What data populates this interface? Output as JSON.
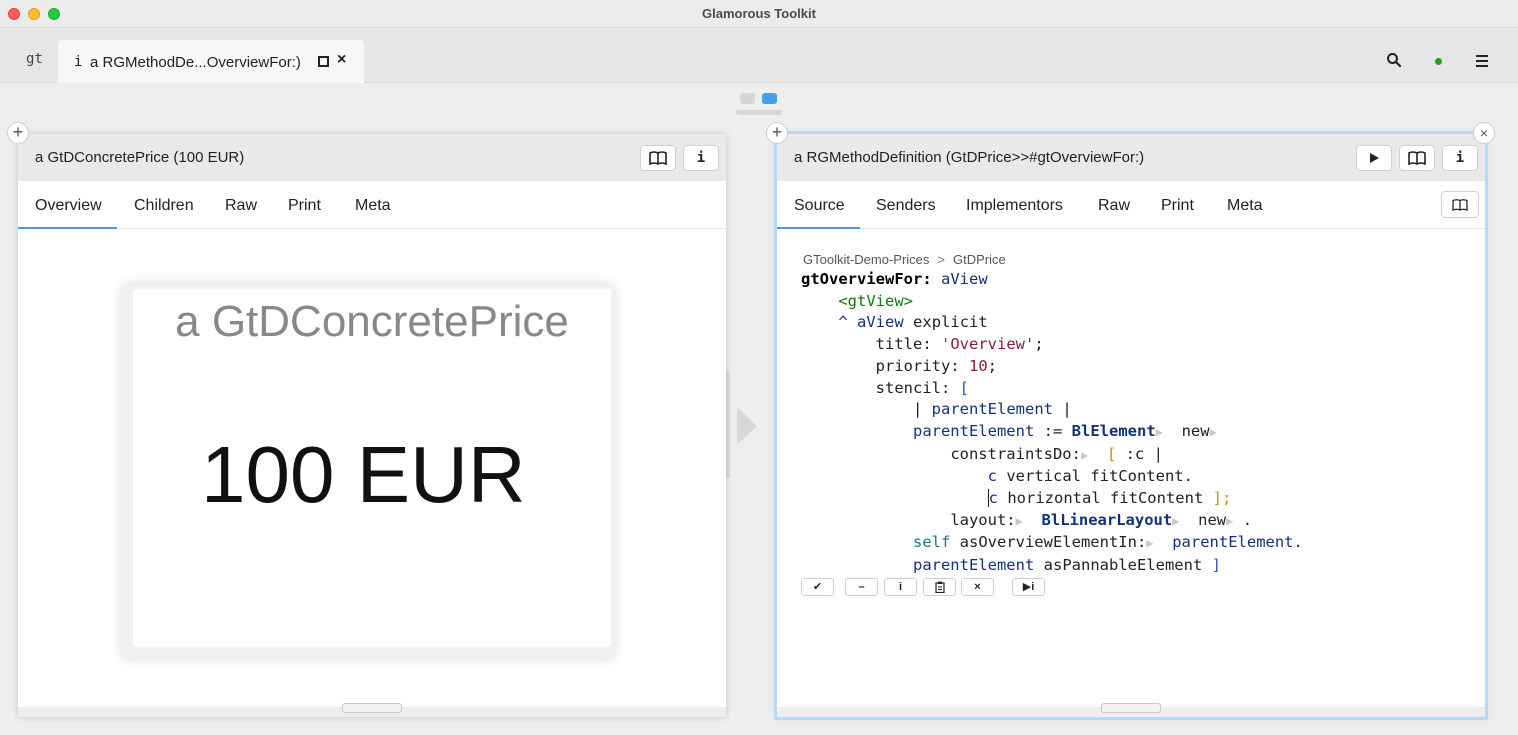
{
  "window": {
    "title": "Glamorous Toolkit"
  },
  "tabbar": {
    "logo": "gt",
    "tab_icon": "i",
    "tab_label": "a RGMethodDe...OverviewFor:)",
    "close_glyph": "×"
  },
  "left_pane": {
    "title": "a GtDConcretePrice (100 EUR)",
    "info_glyph": "i",
    "tabs": [
      "Overview",
      "Children",
      "Raw",
      "Print",
      "Meta"
    ],
    "active_tab": "Overview",
    "card_name": "a GtDConcretePrice",
    "card_price": "100 EUR"
  },
  "right_pane": {
    "title": "a RGMethodDefinition (GtDPrice>>#gtOverviewFor:)",
    "info_glyph": "i",
    "close_glyph": "×",
    "tabs": [
      "Source",
      "Senders",
      "Implementors",
      "Raw",
      "Print",
      "Meta"
    ],
    "active_tab": "Source",
    "breadcrumb": {
      "package": "GToolkit-Demo-Prices",
      "separator": ">",
      "class": "GtDPrice"
    },
    "code": {
      "selector": "gtOverviewFor:",
      "arg": "aView",
      "pragma": "<gtView>",
      "caret": "^",
      "line3_rest": "explicit",
      "title_kw": "title:",
      "title_val": "'Overview'",
      "semicolon": ";",
      "priority_kw": "priority:",
      "priority_val": "10",
      "stencil_kw": "stencil:",
      "open_bracket": "[",
      "temp_var": "parentElement",
      "assign": ":=",
      "class1": "BlElement",
      "new": "new",
      "constraints_kw": "constraintsDo:",
      "block_arg": ":c",
      "pipe": "|",
      "c": "c",
      "vertical": "vertical fitContent.",
      "horizontal": "horizontal fitContent",
      "close_bracket": "];",
      "layout_kw": "layout:",
      "class2": "BlLinearLayout",
      "period": ".",
      "self": "self",
      "as_overview": "asOverviewElementIn:",
      "as_pannable": "asPannableElement",
      "final_bracket": "]"
    },
    "actions": [
      "✔",
      "–",
      "i",
      "",
      "×",
      "▶i"
    ]
  },
  "colors": {
    "accent": "#4a9be0",
    "pager_active": "#3fa3ec",
    "status": "#1fa31f"
  }
}
